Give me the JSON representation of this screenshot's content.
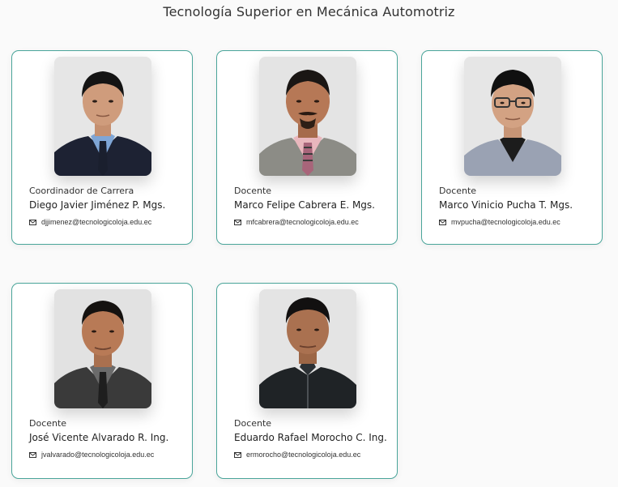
{
  "page": {
    "title": "Tecnología Superior en Mecánica Automotriz"
  },
  "staff": [
    {
      "role": "Coordinador de Carrera",
      "name": "Diego Javier Jiménez P. Mgs.",
      "email": "djjimenez@tecnologicoloja.edu.ec",
      "icon": "envelope-icon"
    },
    {
      "role": "Docente",
      "name": "Marco Felipe Cabrera E. Mgs.",
      "email": "mfcabrera@tecnologicoloja.edu.ec",
      "icon": "envelope-icon"
    },
    {
      "role": "Docente",
      "name": "Marco Vinicio Pucha T. Mgs.",
      "email": "mvpucha@tecnologicoloja.edu.ec",
      "icon": "envelope-icon"
    },
    {
      "role": "Docente",
      "name": "José Vicente Alvarado R. Ing.",
      "email": "jvalvarado@tecnologicoloja.edu.ec",
      "icon": "envelope-icon"
    },
    {
      "role": "Docente",
      "name": "Eduardo Rafael Morocho C. Ing.",
      "email": "ermorocho@tecnologicoloja.edu.ec",
      "icon": "envelope-icon"
    }
  ],
  "colors": {
    "card_border": "#4aa59a",
    "background": "#fafafa"
  }
}
